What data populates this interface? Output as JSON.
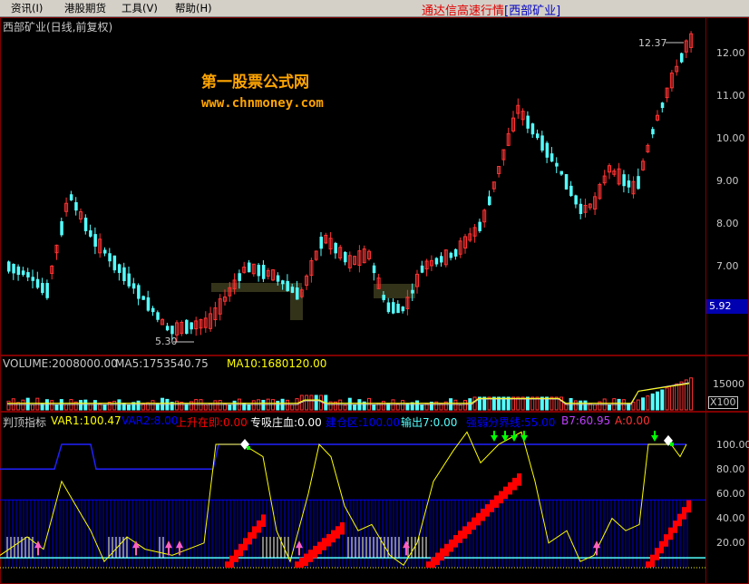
{
  "menu": {
    "items": [
      "资讯(I)",
      "港股期货",
      "工具(V)",
      "帮助(H)"
    ],
    "app_title": "通达信高速行情",
    "stock_tag": "[西部矿业]"
  },
  "main_chart": {
    "title": "西部矿业(日线,前复权)",
    "watermark_cn": "第一股票公式网",
    "watermark_url": "www.chnmoney.com",
    "high_label": "12.37",
    "low_label": "5.30",
    "current_price": "5.92",
    "y_ticks": [
      "12.00",
      "11.00",
      "10.00",
      "9.00",
      "8.00",
      "7.00"
    ]
  },
  "volume_panel": {
    "volume_label": "VOLUME:2008000.00",
    "ma5_label": "MA5:1753540.75",
    "ma10_label": "MA10:1680120.00",
    "y_tick": "15000",
    "multiplier": "X100"
  },
  "indicator_panel": {
    "name": "判顶指标",
    "var1": "VAR1:100.47",
    "var2": "VAR2:8.00",
    "rise": "上升在即:0.00",
    "absorb": "专吸庄血:0.00",
    "position": "建仓区:100.00",
    "output7": "输出7:0.00",
    "weak": "强弱分界线:55.00",
    "b7": "B7:60.95",
    "a": "A:0.00",
    "y_ticks": [
      "100.00",
      "80.00",
      "60.00",
      "40.00",
      "20.00"
    ]
  },
  "colors": {
    "up": "#ff3232",
    "down": "#54ffff",
    "axis": "#800000",
    "yellow": "#ffff00",
    "blue": "#0000ff",
    "red_bar": "#ff0000",
    "green_arrow": "#00ff00"
  }
}
